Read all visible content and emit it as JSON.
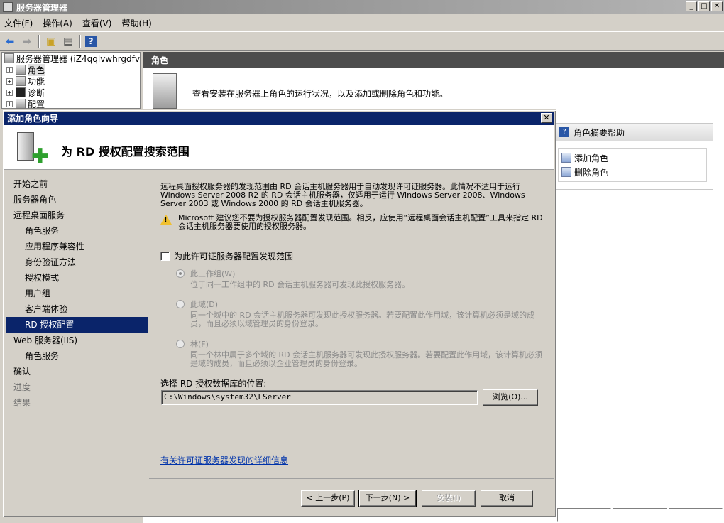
{
  "main_window": {
    "title": "服务器管理器",
    "menu": [
      "文件(F)",
      "操作(A)",
      "查看(V)",
      "帮助(H)"
    ],
    "tree": {
      "root": "服务器管理器 (iZ4qqlvwhrgdfv",
      "items": [
        "角色",
        "功能",
        "诊断",
        "配置"
      ]
    },
    "content_header": "角色",
    "content_desc": "查看安装在服务器上角色的运行状况，以及添加或删除角色和功能。",
    "summary_panel": {
      "title": "角色摘要帮助",
      "links": [
        "添加角色",
        "删除角色"
      ]
    }
  },
  "wizard": {
    "title": "添加角色向导",
    "close_label": "✕",
    "header_title": "为 RD 授权配置搜索范围",
    "nav": [
      {
        "label": "开始之前",
        "level": 0,
        "state": "normal"
      },
      {
        "label": "服务器角色",
        "level": 0,
        "state": "normal"
      },
      {
        "label": "远程桌面服务",
        "level": 0,
        "state": "normal"
      },
      {
        "label": "角色服务",
        "level": 1,
        "state": "normal"
      },
      {
        "label": "应用程序兼容性",
        "level": 1,
        "state": "normal"
      },
      {
        "label": "身份验证方法",
        "level": 1,
        "state": "normal"
      },
      {
        "label": "授权模式",
        "level": 1,
        "state": "normal"
      },
      {
        "label": "用户组",
        "level": 1,
        "state": "normal"
      },
      {
        "label": "客户端体验",
        "level": 1,
        "state": "normal"
      },
      {
        "label": "RD 授权配置",
        "level": 1,
        "state": "selected"
      },
      {
        "label": "Web 服务器(IIS)",
        "level": 0,
        "state": "normal"
      },
      {
        "label": "角色服务",
        "level": 1,
        "state": "normal"
      },
      {
        "label": "确认",
        "level": 0,
        "state": "normal"
      },
      {
        "label": "进度",
        "level": 0,
        "state": "disabled"
      },
      {
        "label": "结果",
        "level": 0,
        "state": "disabled"
      }
    ],
    "intro": "远程桌面授权服务器的发现范围由 RD 会话主机服务器用于自动发现许可证服务器。此情况不适用于运行 Windows Server 2008 R2 的 RD 会话主机服务器，仅适用于运行 Windows Server 2008、Windows Server 2003 或 Windows 2000 的 RD 会话主机服务器。",
    "warning": "Microsoft 建议您不要为授权服务器配置发现范围。相反，应使用“远程桌面会话主机配置”工具来指定 RD 会话主机服务器要使用的授权服务器。",
    "checkbox_label": "为此许可证服务器配置发现范围",
    "checkbox_checked": false,
    "options": [
      {
        "label": "此工作组(W)",
        "desc": "位于同一工作组中的 RD 会话主机服务器可发现此授权服务器。",
        "checked": true
      },
      {
        "label": "此域(D)",
        "desc": "同一个域中的 RD 会话主机服务器可发现此授权服务器。若要配置此作用域，该计算机必须是域的成员，而且必须以域管理员的身份登录。",
        "checked": false
      },
      {
        "label": "林(F)",
        "desc": "同一个林中属于多个域的 RD 会话主机服务器可发现此授权服务器。若要配置此作用域，该计算机必须是域的成员，而且必须以企业管理员的身份登录。",
        "checked": false
      }
    ],
    "path_label": "选择 RD 授权数据库的位置:",
    "path_value": "C:\\Windows\\system32\\LServer",
    "browse_label": "浏览(O)...",
    "more_info_link": "有关许可证服务器发现的详细信息",
    "buttons": {
      "back": "< 上一步(P)",
      "next": "下一步(N) >",
      "install": "安装(I)",
      "cancel": "取消"
    }
  }
}
